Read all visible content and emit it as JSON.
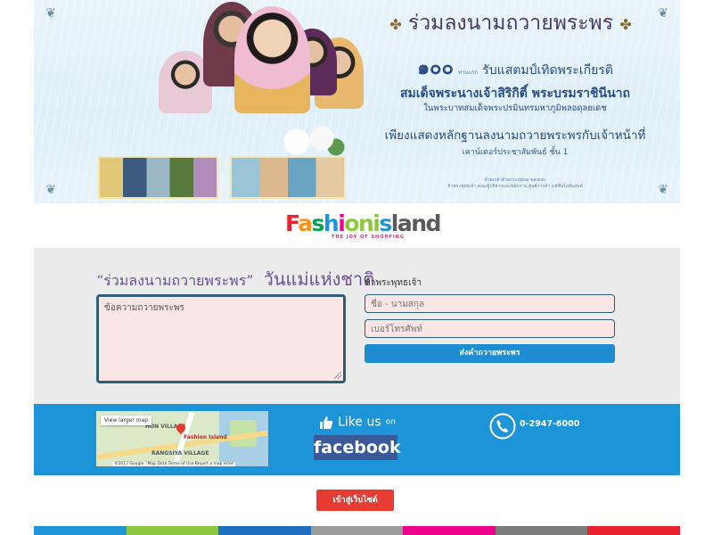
{
  "banner": {
    "title": "ร่วมลงนามถวายพระพร",
    "number": "๑๐๐",
    "number_small": "ท่านแรก",
    "number_text": "รับแสตมป์เทิดพระเกียรติ",
    "queen_name": "สมเด็จพระนางเจ้าสิริกิติ์ พระบรมราชินีนาถ",
    "queen_sub": "ในพระบาทสมเด็จพระปรมินทรมหาภูมิพลอดุลยเดช",
    "instruction": "เพียงแสดงหลักฐานลงนามถวายพระพรกับเจ้าหน้าที่",
    "counter": "เคาน์เตอร์ประชาสัมพันธ์ ชั้น 1",
    "footnote_1": "ด้วยเกล้าด้วยกระหม่อม ขอเดชะ",
    "footnote_2": "ข้าพระพุทธเจ้า คณะผู้บริหารและพนักงาน ศูนย์การค้า แฟชั่นไอส์แลนด์"
  },
  "logo": {
    "word": "Fashionisland",
    "tagline": "THE JOY OF SHOPPING",
    "colors": [
      "#e9232d",
      "#f7941d",
      "#00a651",
      "#1d94d8",
      "#ec008c",
      "#8dc63f",
      "#662d91"
    ]
  },
  "form": {
    "title_quote": "“ร่วมลงนามถวายพระพร”",
    "title_main": "วันแม่แห่งชาติ",
    "message_placeholder": "ข้อความถวายพระพร",
    "signer_label": "ข้าพระพุทธเจ้า",
    "name_placeholder": "ชื่อ - นามสกุล",
    "phone_placeholder": "เบอร์โทรศัพท์",
    "submit_label": "ส่งคำถวายพระพร"
  },
  "footer": {
    "map_button": "View larger map",
    "map_pin_label": "Fashion Island",
    "map_area_1": "HON VILLAGE",
    "map_area_2": "RANGSIYA VILLAGE",
    "map_footer": "©2017 Google · Map Data   Terms of Use   Report a map error",
    "like_text": "Like us",
    "like_on": "on",
    "facebook": "facebook",
    "phone": "0-2947-6000",
    "website_button": "เข้าสู่เว็บไซต์"
  },
  "colors": {
    "blue": "#1d94d8",
    "form_bg": "#ebebeb",
    "button_red": "#e73c34",
    "title_purple": "#6e4f97",
    "stripe": [
      "#1d94d8",
      "#8dc63f",
      "#1e6fbf",
      "#9b9b9b",
      "#ec008c",
      "#7c7c7c",
      "#e9232d"
    ]
  }
}
